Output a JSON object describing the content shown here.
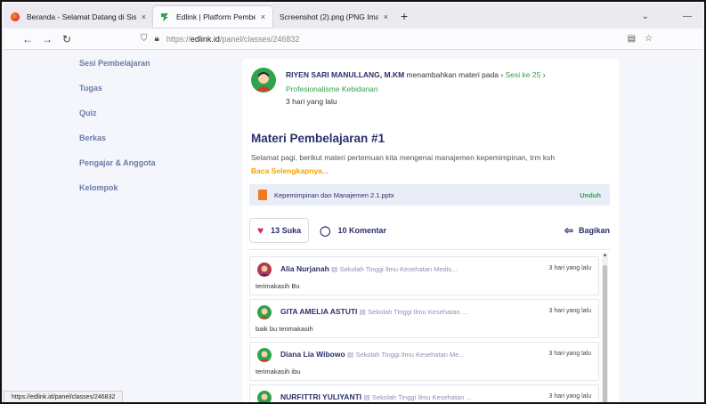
{
  "browser": {
    "tabs": [
      {
        "title": "Beranda - Selamat Datang di Sistem",
        "active": false
      },
      {
        "title": "Edlink | Platform Pembelajaran",
        "active": true
      },
      {
        "title": "Screenshot (2).png (PNG Image, 13(",
        "active": false
      }
    ],
    "close_glyph": "×",
    "new_tab_glyph": "+",
    "url_prefix": "https://",
    "url_host": "edlink.id",
    "url_path": "/panel/classes/246832",
    "status_url": "https://edlink.id/panel/classes/246832"
  },
  "sidebar": {
    "items": [
      {
        "label": "Sesi Pembelajaran"
      },
      {
        "label": "Tugas"
      },
      {
        "label": "Quiz"
      },
      {
        "label": "Berkas"
      },
      {
        "label": "Pengajar & Anggota"
      },
      {
        "label": "Kelompok"
      }
    ]
  },
  "post": {
    "author": "RIYEN SARI MANULLANG, M.KM",
    "action": "menambahkan materi pada",
    "session": "Sesi ke 25",
    "course": "Profesionalisme Kebidanan",
    "time": "3 hari yang lalu",
    "title": "Materi Pembelajaran #1",
    "body": "Selamat pagi, berikut materi pertemuan kita mengenai manajemen kepemimpinan, trm ksh",
    "read_more": "Baca Selengkapnya...",
    "attachment": {
      "filename": "Kepemimpinan dan Manajemen 2.1.pptx",
      "download_label": "Unduh"
    },
    "likes_label": "13 Suka",
    "comments_label": "10 Komentar",
    "share_label": "Bagikan"
  },
  "comments": [
    {
      "name": "Alia Nurjanah",
      "school": "Sekolah Tinggi Ilmu Kesehatan Medis...",
      "time": "3 hari yang lalu",
      "text": "terimakasih Bu"
    },
    {
      "name": "GITA AMELIA ASTUTI",
      "school": "Sekolah Tinggi Ilmu Kesehatan ...",
      "time": "3 hari yang lalu",
      "text": "baik bu terimakasih"
    },
    {
      "name": "Diana Lia Wibowo",
      "school": "Sekolah Tinggi Ilmu Kesehatan Me...",
      "time": "3 hari yang lalu",
      "text": "terimakasih ibu"
    },
    {
      "name": "NURFITTRI YULIYANTI",
      "school": "Sekolah Tinggi Ilmu Kesehatan ...",
      "time": "3 hari yang lalu",
      "text": ""
    }
  ],
  "colors": {
    "accent": "#2b2f6b",
    "green": "#2fa34b",
    "orange": "#f0a500",
    "heart": "#e22850"
  }
}
